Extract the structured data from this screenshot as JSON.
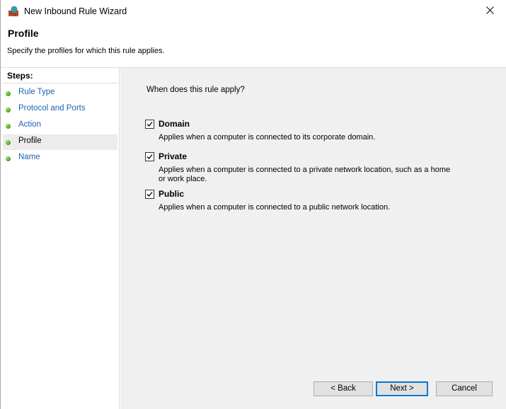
{
  "window": {
    "title": "New Inbound Rule Wizard",
    "close_symbol": "✕"
  },
  "header": {
    "title": "Profile",
    "subtitle": "Specify the profiles for which this rule applies."
  },
  "steps": {
    "heading": "Steps:",
    "items": [
      {
        "label": "Rule Type",
        "current": false
      },
      {
        "label": "Protocol and Ports",
        "current": false
      },
      {
        "label": "Action",
        "current": false
      },
      {
        "label": "Profile",
        "current": true
      },
      {
        "label": "Name",
        "current": false
      }
    ]
  },
  "main": {
    "question": "When does this rule apply?",
    "options": [
      {
        "label": "Domain",
        "checked": true,
        "description": "Applies when a computer is connected to its corporate domain."
      },
      {
        "label": "Private",
        "checked": true,
        "description": "Applies when a computer is connected to a private network location, such as a home or work place."
      },
      {
        "label": "Public",
        "checked": true,
        "description": "Applies when a computer is connected to a public network location."
      }
    ]
  },
  "buttons": {
    "back": "< Back",
    "next": "Next >",
    "cancel": "Cancel"
  },
  "colors": {
    "link": "#1a64b4",
    "content_bg": "#f0f0f0",
    "primary_border": "#0078d7"
  }
}
